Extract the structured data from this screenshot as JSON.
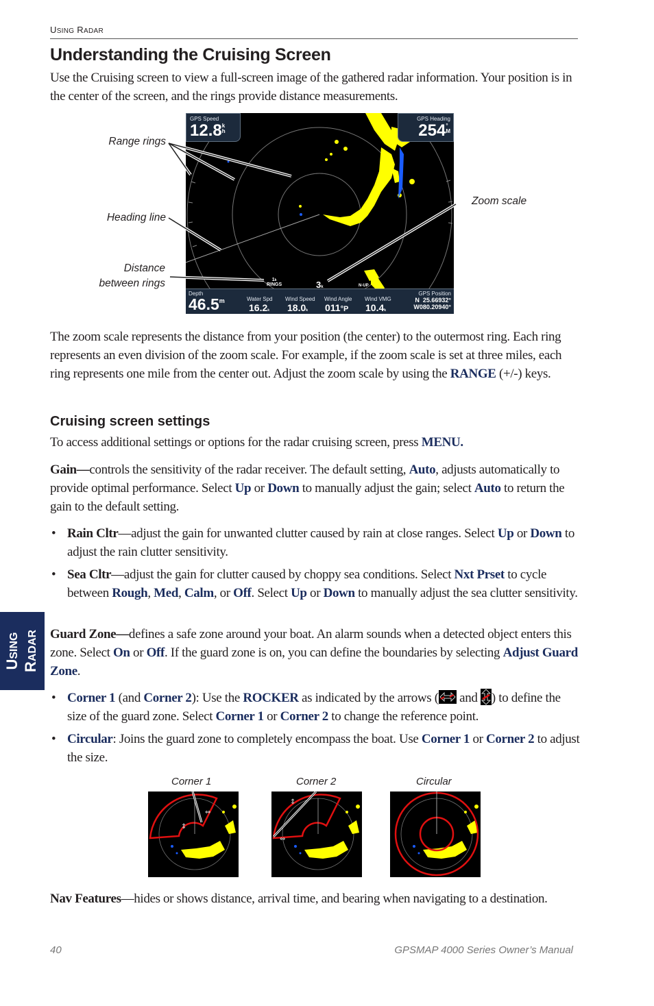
{
  "running_head": {
    "first_cap": "U",
    "first_rest": "SING",
    "second_cap": "R",
    "second_rest": "ADAR"
  },
  "title": "Understanding the Cruising Screen",
  "intro": "Use the Cruising screen to view a full-screen image of the gathered radar information. Your position is in the center of the screen, and the rings provide distance measurements.",
  "radar_screen": {
    "gps_speed": {
      "label": "GPS Speed",
      "value": "12.8",
      "unit_top": "k",
      "unit_bottom": "h"
    },
    "gps_heading": {
      "label": "GPS Heading",
      "value": "254",
      "unit_top": "°",
      "unit_bottom": "M"
    },
    "rings_distance": {
      "value": "1",
      "unit": "k",
      "label": "RINGS"
    },
    "zoom_scale": {
      "value": "3",
      "unit": "k"
    },
    "orientation": "N-UP",
    "depth": {
      "label": "Depth",
      "value": "46.5",
      "unit": "m"
    },
    "water_spd": {
      "label": "Water Spd",
      "value": "16.2",
      "unit": "k/h"
    },
    "wind_speed": {
      "label": "Wind Speed",
      "value": "18.0",
      "unit": "k/h"
    },
    "wind_angle": {
      "label": "Wind Angle",
      "value": "011",
      "unit": "°P"
    },
    "wind_vmg": {
      "label": "Wind VMG",
      "value": "10.4",
      "unit": "k/h"
    },
    "gps_position": {
      "label": "GPS Position",
      "lat": "N  25.66932°",
      "lon": "W080.20940°"
    }
  },
  "callouts": {
    "range_rings": "Range rings",
    "heading_line": "Heading line",
    "distance_line1": "Distance",
    "distance_line2": "between rings",
    "zoom_scale": "Zoom scale"
  },
  "zoom_para": {
    "text": "The zoom scale represents the distance from your position (the center) to the outermost ring. Each ring represents an even division of the zoom scale. For example, if the zoom scale is set at three miles, each ring represents one mile from the center out. Adjust the zoom scale by using the ",
    "key": "RANGE",
    "after": " (+/-) keys."
  },
  "settings": {
    "heading": "Cruising screen settings",
    "intro": "To access additional settings or options for the radar cruising screen, press ",
    "intro_key": "MENU",
    "intro_end": "."
  },
  "gain": {
    "term": "Gain—",
    "t1": "controls the sensitivity of the radar receiver. The default setting, ",
    "k1": "Auto",
    "t2": ", adjusts automatically to provide optimal performance. Select ",
    "k2": "Up",
    "t3": " or ",
    "k3": "Down",
    "t4": " to manually adjust the gain; select ",
    "k4": "Auto",
    "t5": " to return the gain to the default setting."
  },
  "rain": {
    "bullet": "•",
    "term": "Rain Cltr",
    "t1": "—adjust the gain for unwanted clutter caused by rain at close ranges. Select ",
    "k1": "Up",
    "t2": " or ",
    "k2": "Down",
    "t3": " to adjust the rain clutter sensitivity."
  },
  "sea": {
    "bullet": "•",
    "term": "Sea Cltr",
    "t1": "—adjust the gain for clutter caused by choppy sea conditions. Select ",
    "k1": "Nxt Prset",
    "t2": " to cycle between ",
    "k2": "Rough",
    "t3": ", ",
    "k3": "Med",
    "t4": ", ",
    "k4": "Calm",
    "t5": ", or ",
    "k5": "Off",
    "t6": ". Select ",
    "k6": "Up",
    "t7": " or ",
    "k7": "Down",
    "t8": " to manually adjust the sea clutter sensitivity."
  },
  "guard": {
    "term": "Guard Zone—",
    "t1": "defines a safe zone around your boat. An alarm sounds when a detected object enters this zone. Select ",
    "k1": "On",
    "t2": " or ",
    "k2": "Off",
    "t3": ". If the guard zone is on, you can define the boundaries by selecting ",
    "k3": "Adjust Guard Zone",
    "t4": "."
  },
  "corner": {
    "bullet": "•",
    "k1": "Corner 1",
    "t1": " (and ",
    "k2": "Corner 2",
    "t2": "): Use the ",
    "k3": "ROCKER",
    "t3": " as indicated by the arrows (",
    "t4": " and ",
    "t5": ") to define the size of the guard zone. Select ",
    "k4": "Corner 1",
    "t6": " or ",
    "k5": "Corner 2",
    "t7": " to change the reference point."
  },
  "circular": {
    "bullet": "•",
    "k1": "Circular",
    "t1": ": Joins the guard zone to completely encompass the boat. Use ",
    "k2": "Corner 1",
    "t2": " or ",
    "k3": "Corner 2",
    "t3": " to adjust the size."
  },
  "thumbs": {
    "corner1": "Corner 1",
    "corner2": "Corner 2",
    "circular": "Circular"
  },
  "nav": {
    "term": "Nav Features",
    "text": "—hides or shows distance, arrival time, and bearing when navigating to a destination."
  },
  "side_tab": {
    "first_cap": "U",
    "first_rest": "SING",
    "second_cap": "R",
    "second_rest": "ADAR"
  },
  "footer": {
    "page": "40",
    "manual": "GPSMAP 4000 Series Owner’s Manual"
  },
  "colors": {
    "keyword": "#1b2d5e",
    "tab": "#1b2d5e",
    "radar_echo": "#ffff00",
    "guard_zone": "#e01010"
  }
}
